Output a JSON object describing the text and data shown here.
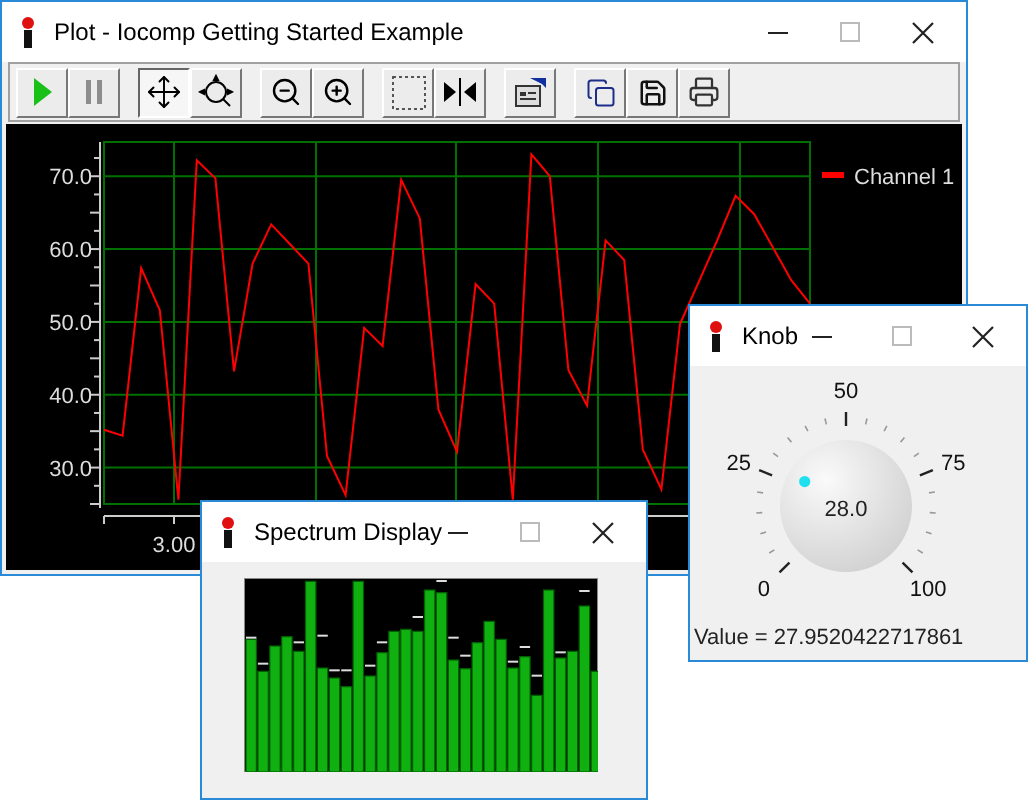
{
  "plot_window": {
    "title": "Plot - Iocomp Getting Started Example",
    "toolbar_groups": [
      [
        {
          "kind": "play",
          "selected": false,
          "disabled": false
        },
        {
          "kind": "pause",
          "selected": false,
          "disabled": true
        }
      ],
      [
        {
          "kind": "pan",
          "selected": true,
          "disabled": false
        },
        {
          "kind": "zoom-box",
          "selected": false,
          "disabled": false
        }
      ],
      [
        {
          "kind": "zoom-out",
          "selected": false,
          "disabled": false
        },
        {
          "kind": "zoom-in",
          "selected": false,
          "disabled": false
        }
      ],
      [
        {
          "kind": "select",
          "selected": false,
          "disabled": false
        },
        {
          "kind": "cursor",
          "selected": false,
          "disabled": false
        }
      ],
      [
        {
          "kind": "properties",
          "selected": false,
          "disabled": false
        }
      ],
      [
        {
          "kind": "copy",
          "selected": false,
          "disabled": false
        },
        {
          "kind": "save",
          "selected": false,
          "disabled": false
        },
        {
          "kind": "print",
          "selected": false,
          "disabled": false
        }
      ]
    ],
    "chart_data": {
      "type": "line",
      "series": [
        {
          "name": "Channel 1",
          "color": "#ff0000",
          "values": [
            35.2,
            34.4,
            57.4,
            51.6,
            25.6,
            72.2,
            69.7,
            43.2,
            58,
            63.4,
            60.7,
            58,
            31.6,
            26.2,
            49.2,
            46.7,
            69.5,
            64.2,
            38,
            32.2,
            55.2,
            52.5,
            25.6,
            73,
            70,
            43.4,
            38.5,
            61.2,
            58.5,
            32.5,
            27,
            49.7,
            null,
            61.2,
            67.3,
            64.8,
            null,
            55.7,
            52.5
          ]
        }
      ],
      "ylim": [
        25,
        74.7
      ],
      "grid": true,
      "annotations": [
        "3.00"
      ],
      "yticks": [
        {
          "value": 30,
          "label": "30.0"
        },
        {
          "value": 40,
          "label": "40.0"
        },
        {
          "value": 50,
          "label": "50.0"
        },
        {
          "value": 60,
          "label": "60.0"
        },
        {
          "value": 70,
          "label": "70.0"
        }
      ]
    }
  },
  "spectrum_window": {
    "title": "Spectrum Display"
  },
  "knob_window": {
    "title": "Knob",
    "scale_labels": [
      "0",
      "25",
      "50",
      "75",
      "100"
    ],
    "value_display": "28.0",
    "level": 0.28,
    "value_text": "Value = 27.9520422717861"
  }
}
